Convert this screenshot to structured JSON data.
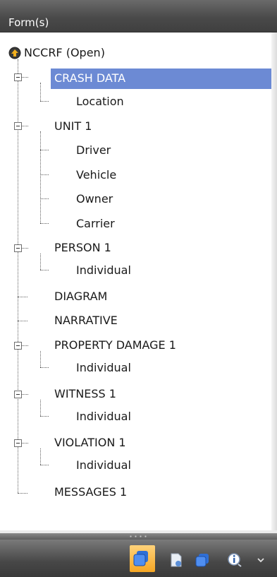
{
  "header": {
    "title": "Form(s)"
  },
  "tree": {
    "root": {
      "label": "NCCRF (Open)",
      "icon": "nccrf-form-icon"
    },
    "nodes": [
      {
        "label": "CRASH DATA",
        "selected": true
      },
      {
        "label": "Location"
      },
      {
        "label": "UNIT 1"
      },
      {
        "label": "Driver"
      },
      {
        "label": "Vehicle"
      },
      {
        "label": "Owner"
      },
      {
        "label": "Carrier"
      },
      {
        "label": "PERSON 1"
      },
      {
        "label": "Individual"
      },
      {
        "label": "DIAGRAM"
      },
      {
        "label": "NARRATIVE"
      },
      {
        "label": "PROPERTY DAMAGE 1"
      },
      {
        "label": "Individual"
      },
      {
        "label": "WITNESS 1"
      },
      {
        "label": "Individual"
      },
      {
        "label": "VIOLATION 1"
      },
      {
        "label": "Individual"
      },
      {
        "label": "MESSAGES 1"
      }
    ]
  },
  "toolbar": {
    "buttons": [
      {
        "icon": "forms-view-icon",
        "active": true
      },
      {
        "icon": "attachment-document-icon"
      },
      {
        "icon": "windows-icon"
      },
      {
        "icon": "info-settings-icon"
      },
      {
        "icon": "chevron-down-icon"
      }
    ]
  },
  "colors": {
    "header_bg": "#4a4a4a",
    "selection": "#6c8ad4",
    "active_button": "#f5a623",
    "tree_lines": "#606060"
  }
}
